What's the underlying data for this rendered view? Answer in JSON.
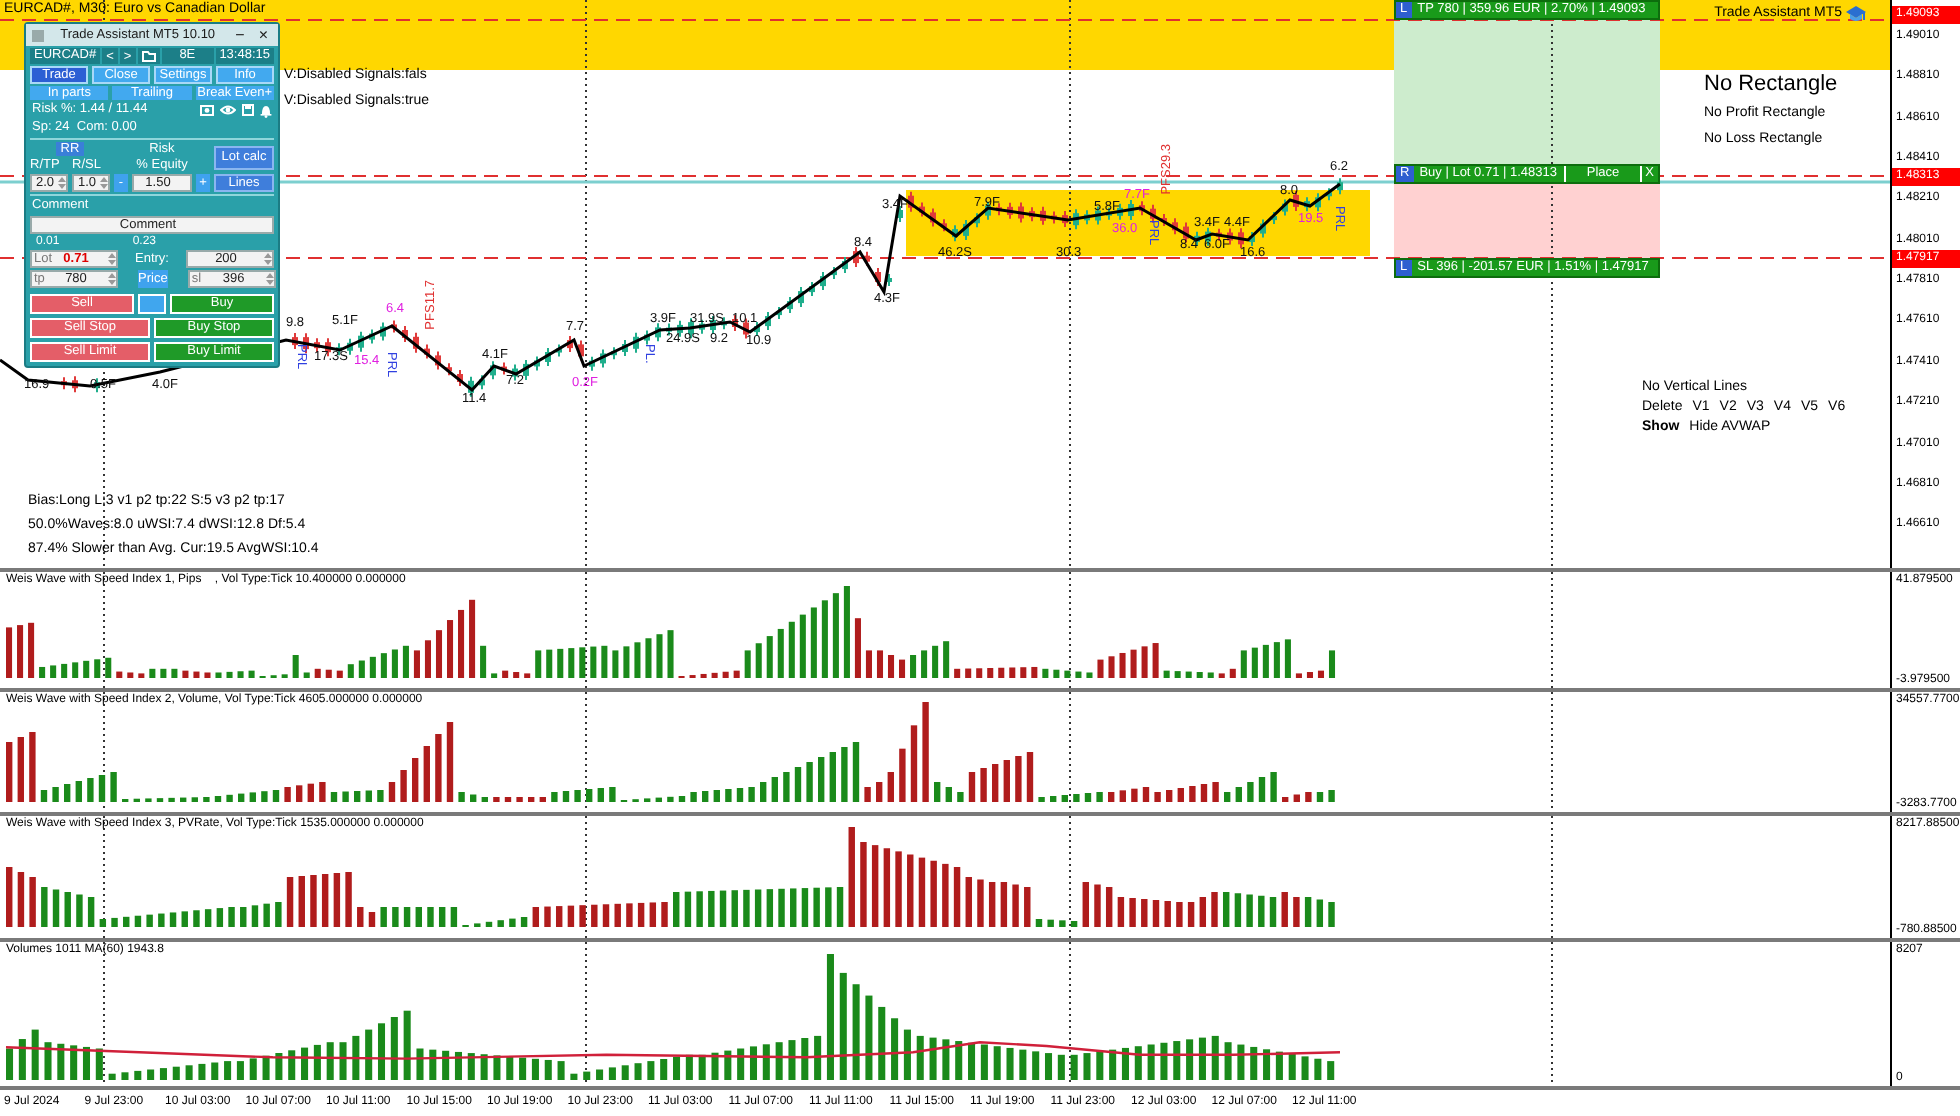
{
  "chart_title": "EURCAD#, M30: Euro vs Canadian Dollar",
  "trade_panel": {
    "title": "Trade Assistant MT5 10.10",
    "minimize": "−",
    "close": "×",
    "symbol": "EURCAD#",
    "prev": "<",
    "next": ">",
    "mode": "8E",
    "time": "13:48:15",
    "tabs": [
      {
        "label": "Trade",
        "selected": true
      },
      {
        "label": "Close",
        "selected": false
      },
      {
        "label": "Settings",
        "selected": false
      },
      {
        "label": "Info",
        "selected": false
      }
    ],
    "subtabs": [
      "In parts",
      "Trailing",
      "Break Even+"
    ],
    "risk_info": "Risk %: 1.44 / 11.44",
    "spread_info": "Sp: 24  Com: 0.00",
    "rr_button": "RR",
    "risk_label": "Risk",
    "lot_calc_button": "Lot calc",
    "rtp_label": "R/TP",
    "rsl_label": "R/SL",
    "equity_label": "% Equity",
    "rtp_value": "2.0",
    "rsl_value": "1.0",
    "minus": "-",
    "risk_value": "1.50",
    "plus": "+",
    "lines_button": "Lines",
    "comment_label": "Comment",
    "comment_value": "Comment",
    "min_lot": "0.01",
    "max_lot": "0.23",
    "lot_label": "Lot",
    "lot_value": "0.71",
    "entry_label": "Entry:",
    "entry_value": "200",
    "tp_label": "tp",
    "tp_value": "780",
    "price_button": "Price",
    "sl_label": "sl",
    "sl_value": "396",
    "orders": [
      {
        "label": "Sell",
        "kind": "sell"
      },
      {
        "label": "Buy",
        "kind": "buy"
      },
      {
        "label": "Sell Stop",
        "kind": "sell"
      },
      {
        "label": "Buy Stop",
        "kind": "buy"
      },
      {
        "label": "Sell Limit",
        "kind": "sell"
      },
      {
        "label": "Buy Limit",
        "kind": "buy"
      }
    ]
  },
  "signals": [
    "V:Disabled Signals:fals",
    "V:Disabled Signals:true"
  ],
  "bias_lines": [
    "Bias:Long L:3 v1 p2 tp:22 S:5 v3 p2 tp:17",
    "50.0%Waves:8.0 uWSI:7.4 dWSI:12.8 Df:5.4",
    "87.4% Slower than Avg. Cur:19.5 AvgWSI:10.4"
  ],
  "trade_levels": {
    "tp": {
      "tag": "L",
      "text": "TP 780 | 359.96 EUR | 2.70% | 1.49093"
    },
    "entry": {
      "tag": "R",
      "text": "Buy | Lot 0.71 | 1.48313",
      "place": "Place",
      "close": "X"
    },
    "sl": {
      "tag": "L",
      "text": "SL 396 | -201.57 EUR | 1.51% | 1.47917"
    }
  },
  "branding": "Trade Assistant MT5",
  "rectangles": {
    "title": "No Rectangle",
    "profit": "No Profit Rectangle",
    "loss": "No Loss Rectangle"
  },
  "vertical_lines": {
    "title": "No Vertical Lines",
    "delete": "Delete",
    "lines": [
      "V1",
      "V2",
      "V3",
      "V4",
      "V5",
      "V6"
    ],
    "show": "Show",
    "hide": "Hide AVWAP"
  },
  "wave_labels": [
    {
      "text": "16.9",
      "kind": "plain"
    },
    {
      "text": "0.5F",
      "kind": "plain"
    },
    {
      "text": "4.0F",
      "kind": "plain"
    },
    {
      "text": "9.8",
      "kind": "plain"
    },
    {
      "text": "5.1F",
      "kind": "plain"
    },
    {
      "text": "17.3S",
      "kind": "plain"
    },
    {
      "text": "15.4",
      "kind": "highlight"
    },
    {
      "text": "6.4",
      "kind": "highlight"
    },
    {
      "text": "PFS11.7",
      "kind": "pfs"
    },
    {
      "text": "PRL",
      "kind": "prl"
    },
    {
      "text": "PRL",
      "kind": "prl"
    },
    {
      "text": "4.1F",
      "kind": "plain"
    },
    {
      "text": "7.2",
      "kind": "plain"
    },
    {
      "text": "11.4",
      "kind": "plain"
    },
    {
      "text": "7.7",
      "kind": "plain"
    },
    {
      "text": "0.2F",
      "kind": "highlight"
    },
    {
      "text": "PL.",
      "kind": "prl"
    },
    {
      "text": "3.9F",
      "kind": "plain"
    },
    {
      "text": "24.9S",
      "kind": "plain"
    },
    {
      "text": "31.9S",
      "kind": "plain"
    },
    {
      "text": "9.2",
      "kind": "plain"
    },
    {
      "text": "10.1",
      "kind": "plain"
    },
    {
      "text": "10.9",
      "kind": "plain"
    },
    {
      "text": "8.4",
      "kind": "plain"
    },
    {
      "text": "4.3F",
      "kind": "plain"
    },
    {
      "text": "3.4F",
      "kind": "plain"
    },
    {
      "text": "46.2S",
      "kind": "plain"
    },
    {
      "text": "7.9F",
      "kind": "plain"
    },
    {
      "text": "30.3",
      "kind": "plain"
    },
    {
      "text": "5.8F",
      "kind": "plain"
    },
    {
      "text": "7.7F",
      "kind": "highlight"
    },
    {
      "text": "36.0",
      "kind": "highlight"
    },
    {
      "text": "PFS29.3",
      "kind": "pfs"
    },
    {
      "text": "PRL",
      "kind": "prl"
    },
    {
      "text": "3.4F",
      "kind": "plain"
    },
    {
      "text": "4.4F",
      "kind": "plain"
    },
    {
      "text": "8.4",
      "kind": "plain"
    },
    {
      "text": "6.0F",
      "kind": "plain"
    },
    {
      "text": "16.6",
      "kind": "plain"
    },
    {
      "text": "8.0",
      "kind": "plain"
    },
    {
      "text": "19.5",
      "kind": "highlight"
    },
    {
      "text": "PRL",
      "kind": "prl"
    },
    {
      "text": "6.2",
      "kind": "plain"
    }
  ],
  "price_axis": {
    "ticks": [
      "1.49010",
      "1.48810",
      "1.48610",
      "1.48410",
      "1.48210",
      "1.48010",
      "1.47810",
      "1.47610",
      "1.47410",
      "1.47210",
      "1.47010",
      "1.46810",
      "1.46610"
    ],
    "tags": [
      "1.49093",
      "1.48313",
      "1.47917"
    ]
  },
  "indicators": [
    {
      "title": "Weis Wave with Speed Index 1, Pips    , Vol Type:Tick 10.400000 0.000000",
      "max": "41.879500",
      "min": "-3.979500",
      "kind": "wave"
    },
    {
      "title": "Weis Wave with Speed Index 2, Volume, Vol Type:Tick 4605.000000 0.000000",
      "max": "34557.7700",
      "min": "-3283.7700",
      "kind": "wave"
    },
    {
      "title": "Weis Wave with Speed Index 3, PVRate, Vol Type:Tick 1535.000000 0.000000",
      "max": "8217.88500",
      "min": "-780.88500",
      "kind": "wave"
    },
    {
      "title": "Volumes 1011 MA(60) 1943.8",
      "max": "8207",
      "min": "0",
      "kind": "volume"
    }
  ],
  "time_axis": [
    "9 Jul 2024",
    "9 Jul 23:00",
    "10 Jul 03:00",
    "10 Jul 07:00",
    "10 Jul 11:00",
    "10 Jul 15:00",
    "10 Jul 19:00",
    "10 Jul 23:00",
    "11 Jul 03:00",
    "11 Jul 07:00",
    "11 Jul 11:00",
    "11 Jul 15:00",
    "11 Jul 19:00",
    "11 Jul 23:00",
    "12 Jul 03:00",
    "12 Jul 07:00",
    "12 Jul 11:00"
  ]
}
